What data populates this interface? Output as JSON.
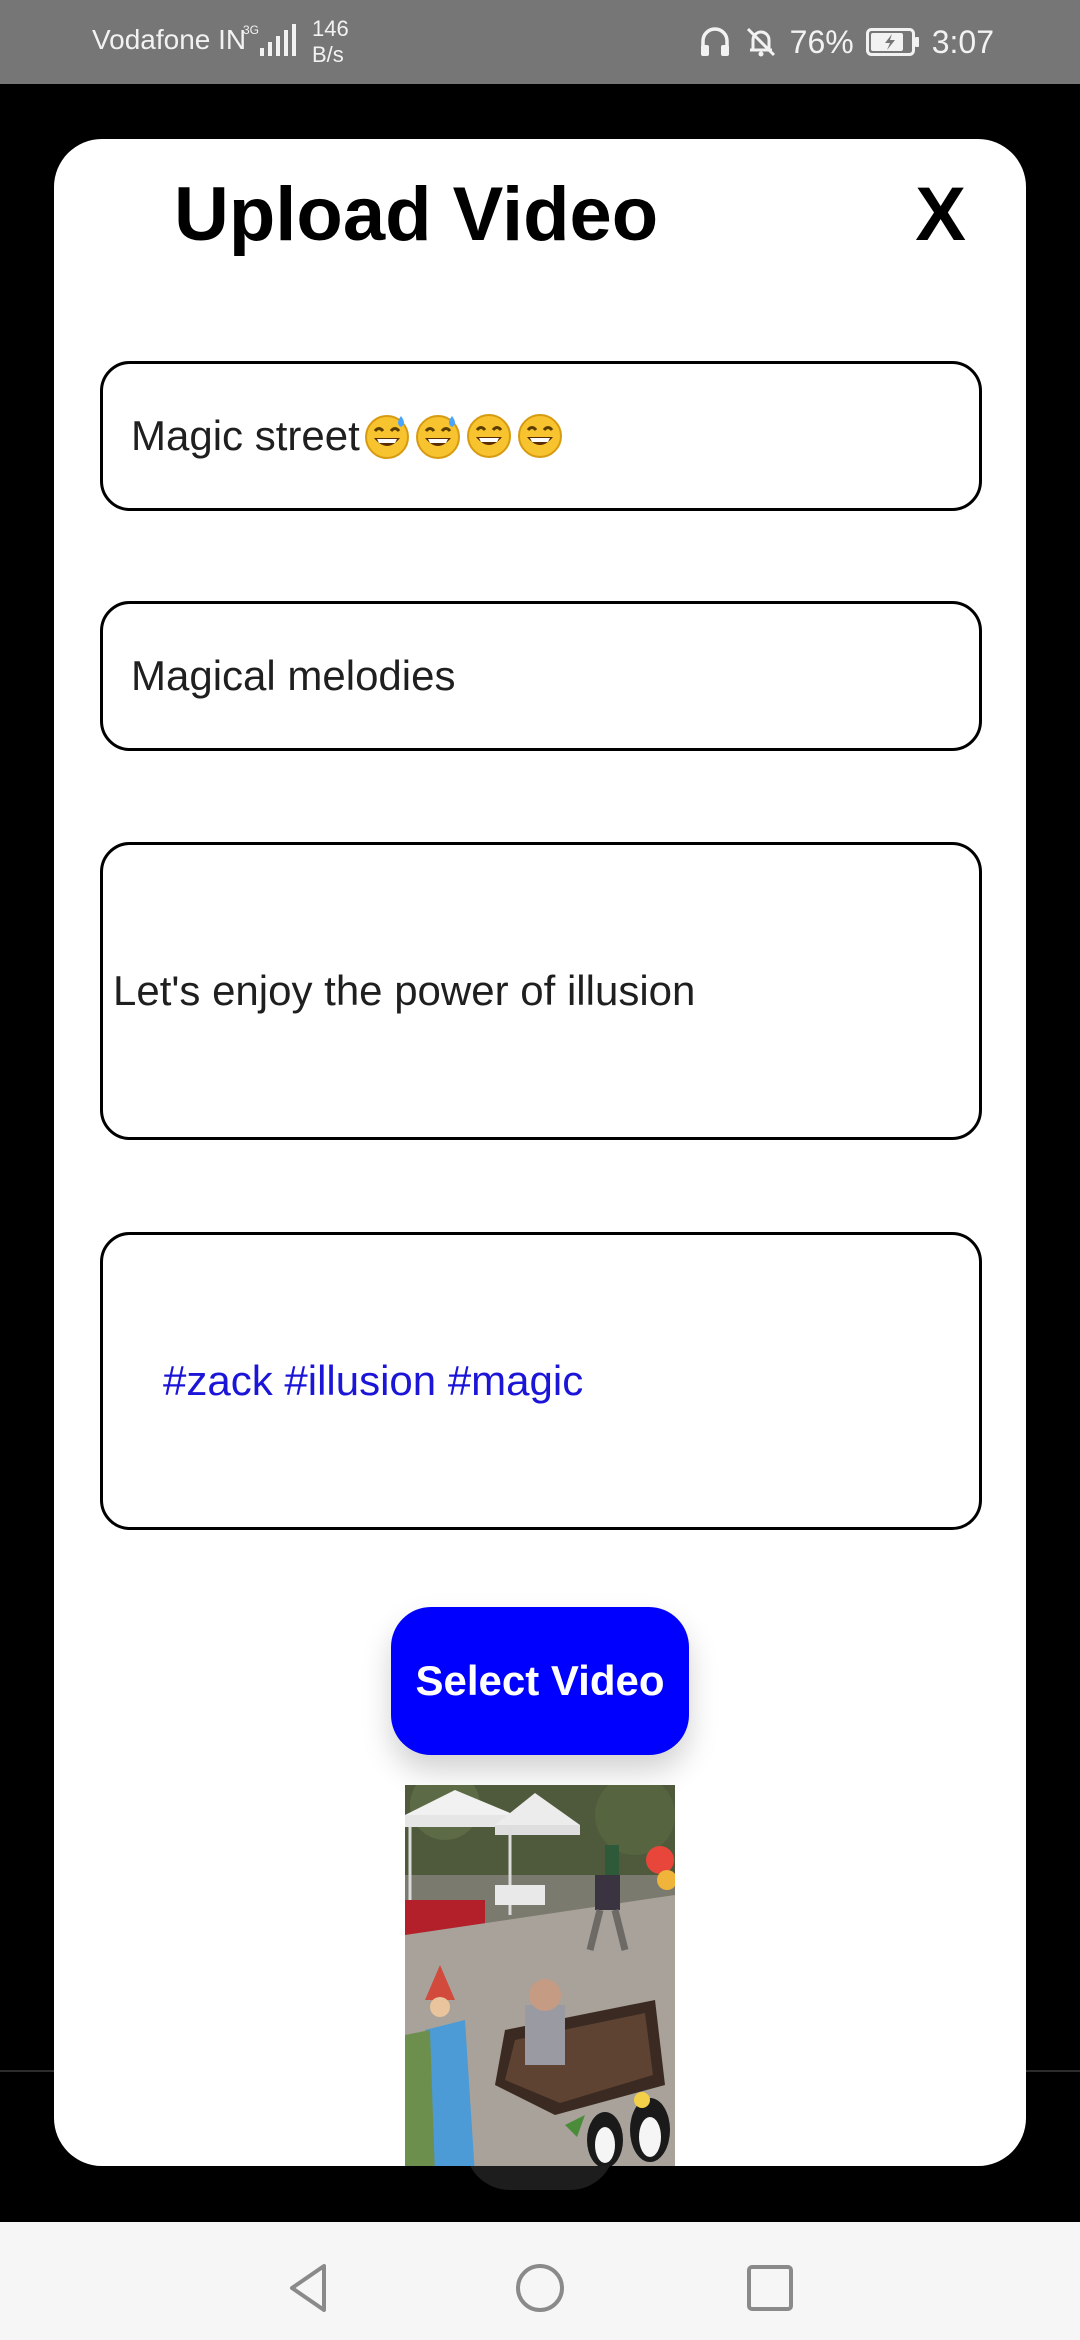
{
  "status_bar": {
    "carrier": "Vodafone IN",
    "network_type": "3G",
    "net_speed_value": "146",
    "net_speed_unit": "B/s",
    "battery_percent": "76%",
    "time": "3:07",
    "icons": [
      "headphones-icon",
      "bell-off-icon",
      "signal-icon",
      "battery-charging-icon"
    ]
  },
  "dialog": {
    "title": "Upload Video",
    "close_label": "X"
  },
  "form": {
    "title_value": "Magic street",
    "title_emojis": [
      "grinning-sweat-emoji",
      "grinning-sweat-emoji",
      "grinning-emoji",
      "grinning-emoji"
    ],
    "genre_value": "Magical melodies",
    "description_value": "Let's enjoy the power of illusion",
    "tags_value": "#zack #illusion #magic",
    "tags_color": "#1b15d8"
  },
  "select_button": {
    "label": "Select Video",
    "color": "#0000ff"
  },
  "nav_bar": {
    "icons": [
      "back-icon",
      "home-icon",
      "recents-icon"
    ]
  }
}
